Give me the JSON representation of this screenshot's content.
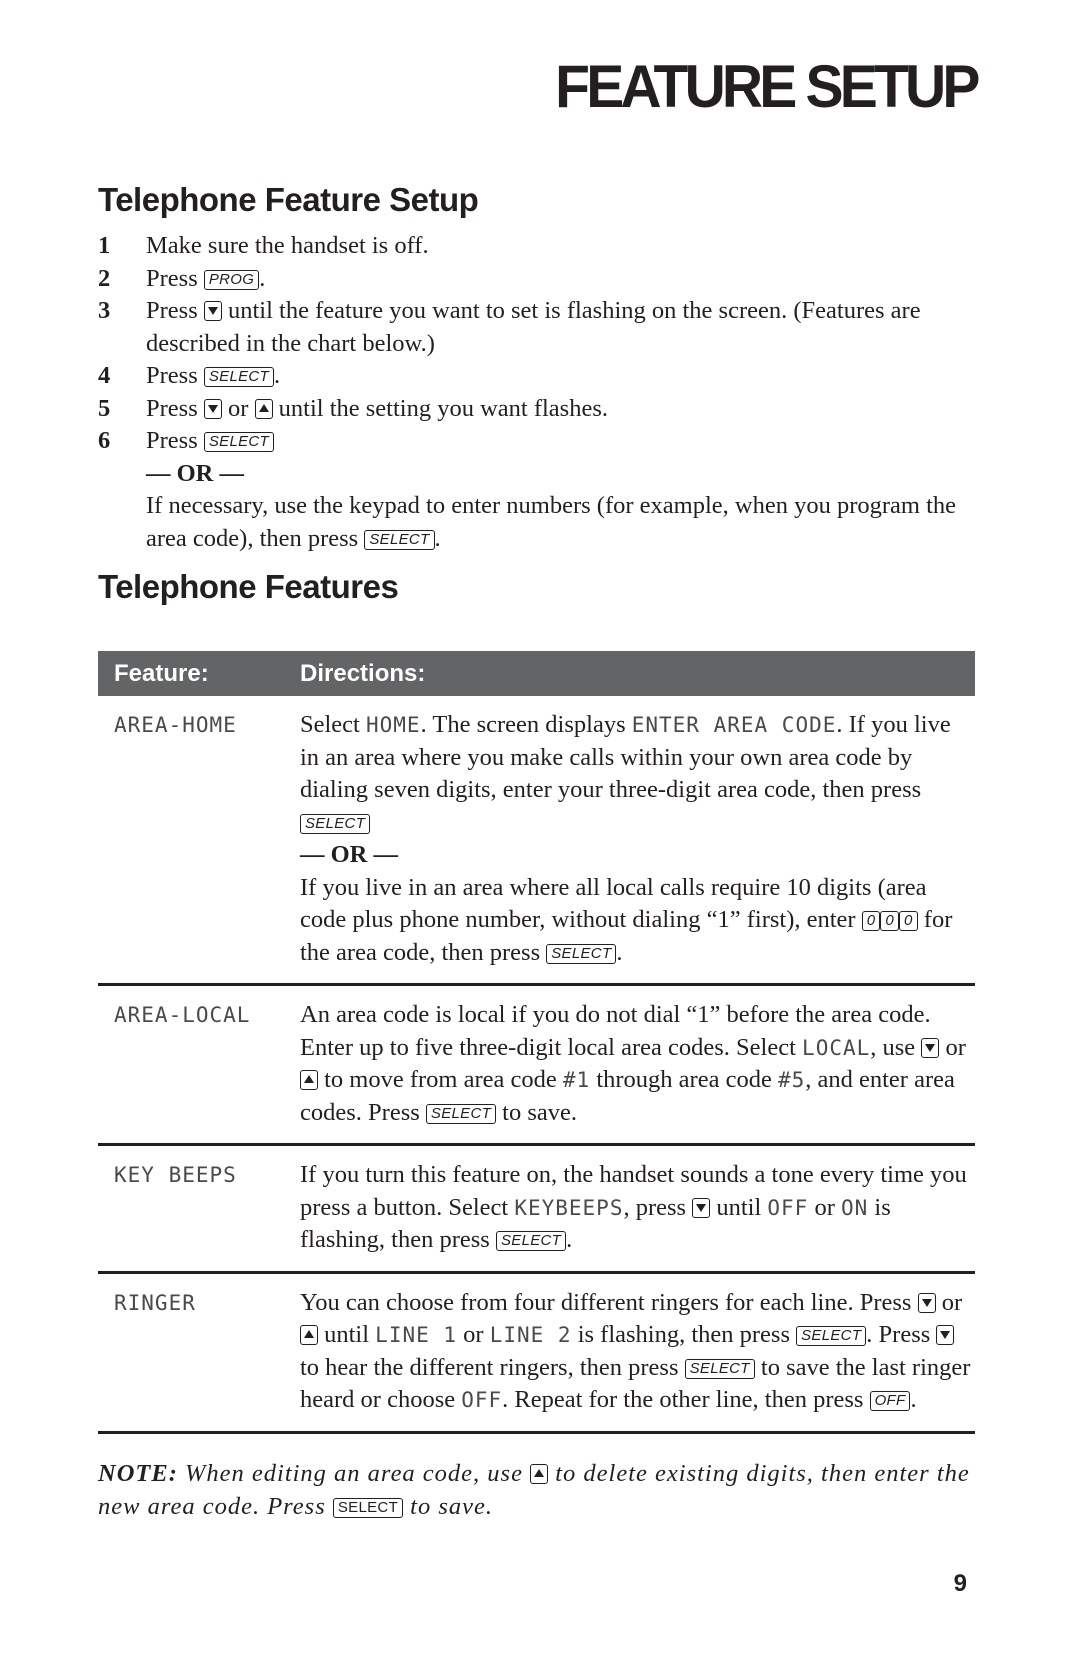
{
  "page": {
    "title": "FEATURE SETUP",
    "page_number": "9"
  },
  "setup": {
    "heading": "Telephone Feature Setup",
    "steps": [
      {
        "num": "1",
        "text": "Make sure the handset is off."
      },
      {
        "num": "2",
        "before": "Press ",
        "key": "PROG",
        "after": "."
      },
      {
        "num": "3",
        "before": "Press ",
        "after": " until the feature you want to set is flashing on the screen. (Features are described in the chart below.)"
      },
      {
        "num": "4",
        "before": "Press ",
        "key": "SELECT",
        "after": "."
      },
      {
        "num": "5",
        "before": "Press ",
        "mid": " or ",
        "after": " until the setting you want flashes."
      },
      {
        "num": "6",
        "before": "Press ",
        "key": "SELECT",
        "or": "— OR —",
        "cont1": "If necessary, use the keypad to enter numbers (for example, when you program the area code), then press ",
        "key2": "SELECT",
        "cont2": "."
      }
    ]
  },
  "features": {
    "heading": "Telephone Features",
    "columns": [
      "Feature:",
      "Directions:"
    ],
    "rows": [
      {
        "feature": "AREA-HOME",
        "t1": "Select ",
        "lcd1": "HOME",
        "t2": ". The screen displays ",
        "lcd2": "ENTER AREA CODE",
        "t3": ". If you live in an area where you make calls within your own area code by dialing seven digits, enter your three-digit area code, then press ",
        "key1": "SELECT",
        "or": "— OR —",
        "t4": "If you live in an area where all local calls require 10 digits (area code plus phone number, without dialing “1” first), enter ",
        "digit_keys": [
          "0",
          "0",
          "0"
        ],
        "t5": " for the area code, then press ",
        "key2": "SELECT",
        "t6": "."
      },
      {
        "feature": "AREA-LOCAL",
        "t1": "An area code is local if you do not dial “1” before the area code.  Enter up to five three-digit local area codes.  Select ",
        "lcd1": "LOCAL",
        "t2": ", use ",
        "t3": " or ",
        "t4": " to move from area code ",
        "lcd2": "#1",
        "t5": " through area code ",
        "lcd3": "#5",
        "t6": ", and enter area codes.  Press ",
        "key1": "SELECT",
        "t7": " to save."
      },
      {
        "feature": "KEY BEEPS",
        "t1": "If you turn this feature on, the handset sounds a tone every time you press a button.  Select ",
        "lcd1": "KEYBEEPS",
        "t2": ", press ",
        "t3": " until ",
        "lcd2": "OFF",
        "t4": " or ",
        "lcd3": "ON",
        "t5": " is flashing, then press ",
        "key1": "SELECT",
        "t6": "."
      },
      {
        "feature": "RINGER",
        "t1": "You can choose from four different ringers for each line. Press ",
        "t2": " or ",
        "t3": " until ",
        "lcd1": "LINE 1",
        "t4": " or ",
        "lcd2": "LINE 2",
        "t5": " is flashing, then press ",
        "key1": "SELECT",
        "t6": ".  Press ",
        "t7": " to hear the different ringers, then press ",
        "key2": "SELECT",
        "t8": " to save the last ringer heard or choose ",
        "lcd3": "OFF",
        "t9": ". Repeat for the other line, then press ",
        "key3": "OFF",
        "t10": "."
      }
    ]
  },
  "note": {
    "label": "NOTE:",
    "t1": " When editing an area code, use ",
    "t2": " to delete existing digits, then enter the new area code.  Press ",
    "key": "SELECT",
    "t3": " to save."
  }
}
